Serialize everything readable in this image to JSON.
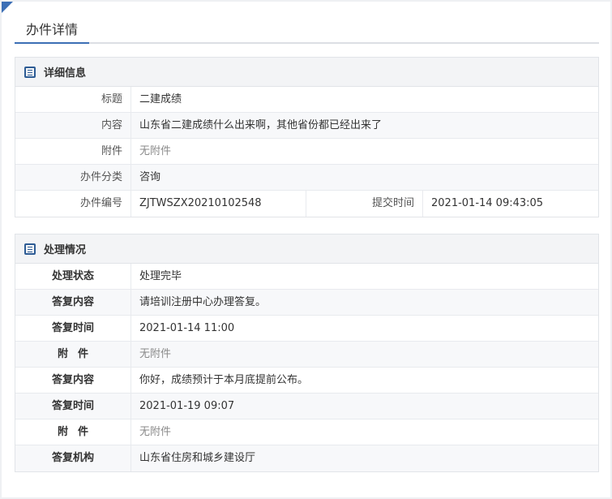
{
  "page": {
    "title": "办件详情"
  },
  "detail": {
    "title": "详细信息",
    "fields": {
      "title_label": "标题",
      "title_value": "二建成绩",
      "content_label": "内容",
      "content_value": "山东省二建成绩什么出来啊，其他省份都已经出来了",
      "attach_label": "附件",
      "attach_value": "无附件",
      "category_label": "办件分类",
      "category_value": "咨询",
      "number_label": "办件编号",
      "number_value": "ZJTWSZX20210102548",
      "submit_label": "提交时间",
      "submit_value": "2021-01-14 09:43:05"
    }
  },
  "handling": {
    "title": "处理情况",
    "rows": [
      {
        "label": "处理状态",
        "value": "处理完毕"
      },
      {
        "label": "答复内容",
        "value": "请培训注册中心办理答复。"
      },
      {
        "label": "答复时间",
        "value": "2021-01-14 11:00"
      },
      {
        "label": "附件",
        "value": "无附件"
      },
      {
        "label": "答复内容",
        "value": "你好，成绩预计于本月底提前公布。"
      },
      {
        "label": "答复时间",
        "value": "2021-01-19 09:07"
      },
      {
        "label": "附件",
        "value": "无附件"
      },
      {
        "label": "答复机构",
        "value": "山东省住房和城乡建设厅"
      }
    ]
  },
  "colors": {
    "accent": "#3c6fb5",
    "icon": "#2e5c95"
  },
  "icons": {
    "section": "document-list-icon"
  }
}
